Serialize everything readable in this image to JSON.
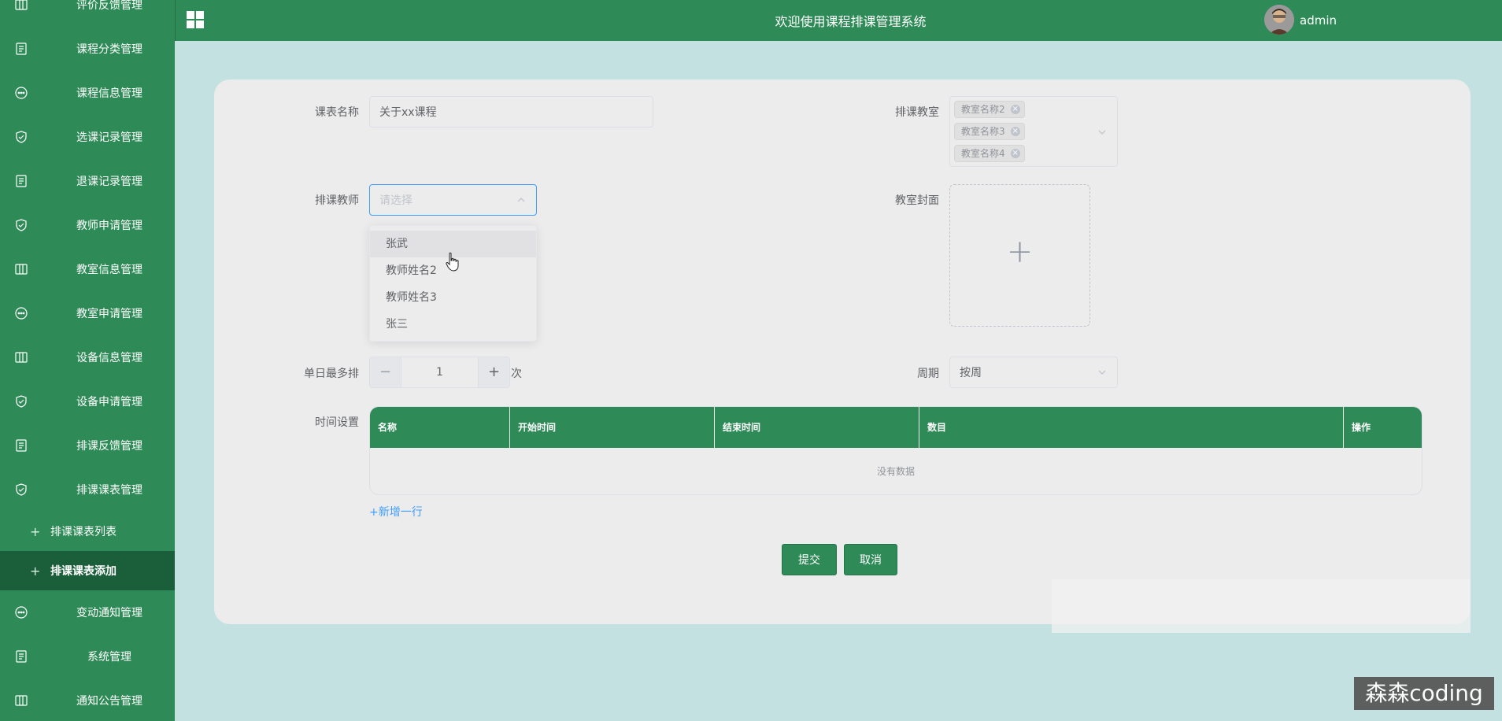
{
  "header": {
    "title": "欢迎使用课程排课管理系统",
    "user": "admin"
  },
  "sidebar": {
    "items": [
      {
        "label": "评价反馈管理",
        "icon": "columns-icon"
      },
      {
        "label": "课程分类管理",
        "icon": "document-icon"
      },
      {
        "label": "课程信息管理",
        "icon": "chat-icon"
      },
      {
        "label": "选课记录管理",
        "icon": "shield-check-icon"
      },
      {
        "label": "退课记录管理",
        "icon": "document-icon"
      },
      {
        "label": "教师申请管理",
        "icon": "shield-check-icon"
      },
      {
        "label": "教室信息管理",
        "icon": "columns-icon"
      },
      {
        "label": "教室申请管理",
        "icon": "chat-icon"
      },
      {
        "label": "设备信息管理",
        "icon": "columns-icon"
      },
      {
        "label": "设备申请管理",
        "icon": "shield-check-icon"
      },
      {
        "label": "排课反馈管理",
        "icon": "document-icon"
      },
      {
        "label": "排课课表管理",
        "icon": "shield-check-icon"
      }
    ],
    "sub_items": [
      {
        "label": "排课课表列表"
      },
      {
        "label": "排课课表添加"
      }
    ],
    "items_after": [
      {
        "label": "变动通知管理",
        "icon": "chat-icon"
      },
      {
        "label": "系统管理",
        "icon": "document-icon"
      },
      {
        "label": "通知公告管理",
        "icon": "columns-icon"
      }
    ]
  },
  "form": {
    "schedule_name": {
      "label": "课表名称",
      "value": "关于xx课程"
    },
    "classroom": {
      "label": "排课教室",
      "tags": [
        "教室名称2",
        "教室名称3",
        "教室名称4"
      ]
    },
    "teacher": {
      "label": "排课教师",
      "placeholder": "请选择",
      "options": [
        "张武",
        "教师姓名2",
        "教师姓名3",
        "张三"
      ]
    },
    "cover": {
      "label": "教室封面"
    },
    "max_per_day": {
      "label": "单日最多排",
      "value": "1",
      "unit": "次"
    },
    "cycle": {
      "label": "周期",
      "value": "按周"
    },
    "time_settings": {
      "label": "时间设置",
      "columns": [
        "名称",
        "开始时间",
        "结束时间",
        "数目",
        "操作"
      ],
      "empty_text": "没有数据",
      "add_row": "+新增一行"
    },
    "submit": "提交",
    "cancel": "取消"
  },
  "watermark": "森森coding",
  "colors": {
    "primary": "#2e8b57",
    "page_bg": "#c3e1e0",
    "card_bg": "#ececec",
    "link": "#409eff"
  }
}
